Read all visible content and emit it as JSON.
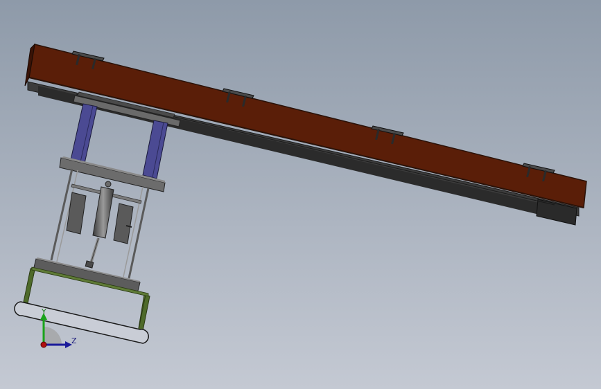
{
  "viewport": {
    "background_top": "#8e9aa9",
    "background_bottom": "#c4c9d3"
  },
  "model": {
    "beam_color": "#5a1e08",
    "beam_edge_color": "#2a1208",
    "column_color": "#4b4a93",
    "plate_color": "#6a6a6a",
    "frame_color": "#4e6a2a",
    "cylinder_color": "#5a5a5a",
    "bracket_color": "#3a3a3a",
    "bracket_count": 4
  },
  "triad": {
    "y_label": "Y",
    "z_label": "Z",
    "y_color": "#1aa31a",
    "z_color": "#1a1aa3",
    "origin_color": "#b01010"
  }
}
